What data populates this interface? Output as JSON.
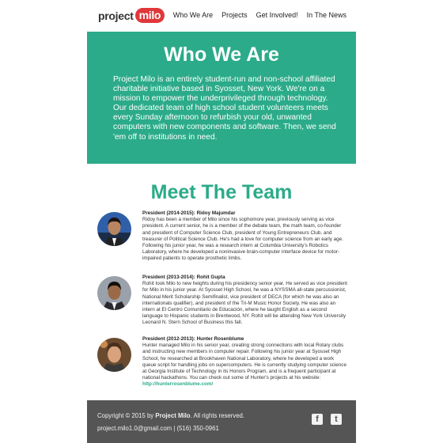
{
  "logo": {
    "word": "project",
    "badge": "milo"
  },
  "nav": [
    {
      "label": "Who We Are"
    },
    {
      "label": "Projects"
    },
    {
      "label": "Get Involved!"
    },
    {
      "label": "In The News"
    }
  ],
  "hero": {
    "title": "Who We Are",
    "body": "Project Milo is an entirely student-run and non-school affiliated charitable initiative based in Syosset, New York. We're on a mission to empower the underprivileged through technology. Our dedicated team of high school student volunteers meets every Sunday afternoon to refurbish your old, unwanted computers with new components and software. Then, we send 'em off to institutions in need."
  },
  "team": {
    "title": "Meet The Team",
    "members": [
      {
        "role": "President (2014-2015): Ridoy Majumdar",
        "bio": "Ridoy has been a member of Milo since his sophomore year, previously serving as vice president. A current senior, he is a member of the debate team, the math team, co-founder and president of Computer Science Club, president of Young Entrepreneurs Club, and treasurer of Political Science Club. He's had a love for computer science from an early age. Following his junior year, he was a research intern at Columbia University's Robotics Laboratory, where he developed a noninvasive brain-computer interface device for motor-impaired patients to operate prosthetic limbs."
      },
      {
        "role": "President (2013-2014): Rohit Gupta",
        "bio": "Rohit took Milo to new heights during his presidency senior year. He served as vice president for Milo in his junior year. At Syosset High School, he was a NYSSMA all-state percussionist, National Merit Scholarship Semifinalist, vice president of DECA (for which he was also an internationals qualifier), and president of the Tri-M Music Honor Society. He was also an intern at El Centro Comunitario de Educación, where he taught English as a second language to Hispanic students in Brentwood, NY. Rohit will be attending New York University Leonard N. Stern School of Business this fall."
      },
      {
        "role": "President (2012-2013): Hunter Rosenblume",
        "bio": "Hunter managed Milo in his senior year, creating strong connections with local Rotary clubs and instructing new members in computer repair. Following his junior year at Syosset High School, he researched at Brookhaven National Laboratory, where he developed a work queue script for handling jobs on supercomputers. He is currently studying computer science at Georgia Institute of Technology in its Honors Program, and is a frequent participant at national hackathons. You can check out some of Hunter's projects at his website: ",
        "link": "http://hunterrosenblume.com/"
      }
    ]
  },
  "footer": {
    "copy_prefix": "Copyright © 2015 by",
    "copy_brand": "Project Milo",
    "copy_suffix": ". All rights reserved.",
    "contact": "project.milo1.0@gmail.com | (516) 350-0961",
    "social": [
      {
        "icon": "facebook-icon",
        "glyph": "f"
      },
      {
        "icon": "twitter-icon",
        "glyph": "t"
      }
    ]
  },
  "colors": {
    "accent": "#2bab89",
    "brand_red": "#e0373a",
    "footer_bg": "#555555"
  }
}
